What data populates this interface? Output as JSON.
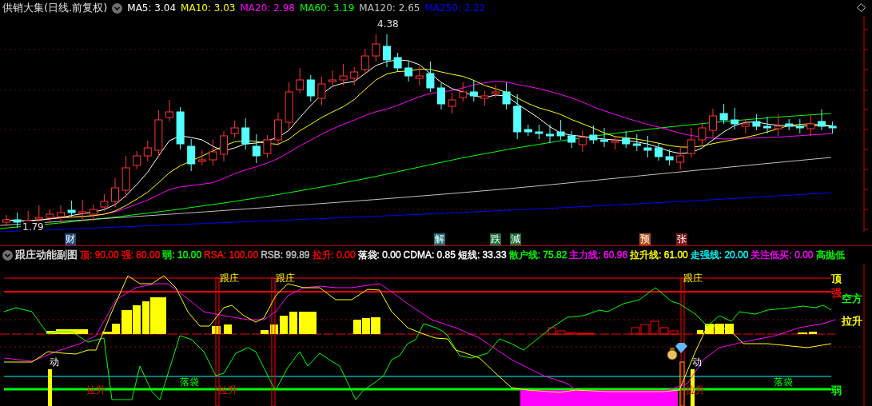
{
  "main_panel": {
    "title": "供销大集(日线.前复权)",
    "indicators": [
      {
        "label": "MA5:",
        "value": "3.04",
        "color": "#ffffff"
      },
      {
        "label": "MA10:",
        "value": "3.03",
        "color": "#ffff00"
      },
      {
        "label": "MA20:",
        "value": "2.98",
        "color": "#ff00ff"
      },
      {
        "label": "MA60:",
        "value": "3.19",
        "color": "#00ff00"
      },
      {
        "label": "MA120:",
        "value": "2.65",
        "color": "#c0c0c0"
      },
      {
        "label": "MA250:",
        "value": "2.22",
        "color": "#0000ff"
      }
    ],
    "high_label": "4.38",
    "low_label": "1.79"
  },
  "event_markers": [
    {
      "text": "财",
      "color": "#1e4a7a"
    },
    {
      "text": "解",
      "color": "#1a6e7a"
    },
    {
      "text": "跌",
      "color": "#1e6e3a"
    },
    {
      "text": "減",
      "color": "#1e6e3a"
    },
    {
      "text": "预",
      "color": "#b0501a"
    },
    {
      "text": "张",
      "color": "#7a1a1a"
    }
  ],
  "sub_panel": {
    "title": "跟庄动能副图",
    "indicators": [
      {
        "label": "顶:",
        "value": "90.00",
        "color": "#ff0000"
      },
      {
        "label": "强:",
        "value": "80.00",
        "color": "#ff0000"
      },
      {
        "label": "弱:",
        "value": "10.00",
        "color": "#00ff00"
      },
      {
        "label": "RSA:",
        "value": "100.00",
        "color": "#ff0000"
      },
      {
        "label": "RSB:",
        "value": "99.89",
        "color": "#c0c0c0"
      },
      {
        "label": "拉升:",
        "value": "0.00",
        "color": "#ff0000"
      },
      {
        "label": "落袋:",
        "value": "0.00",
        "color": "#ffffff"
      },
      {
        "label": "CDMA:",
        "value": "0.85",
        "color": "#ffffff"
      },
      {
        "label": "短线:",
        "value": "33.33",
        "color": "#ffffff"
      },
      {
        "label": "散户线:",
        "value": "75.82",
        "color": "#00ff00"
      },
      {
        "label": "主力线:",
        "value": "60.96",
        "color": "#ff00ff"
      },
      {
        "label": "拉升线:",
        "value": "61.00",
        "color": "#ffff00"
      },
      {
        "label": "走强线:",
        "value": "20.00",
        "color": "#00ffff"
      },
      {
        "label": "关注低买:",
        "value": "0.00",
        "color": "#ff00ff"
      },
      {
        "label": "高抛低",
        "color": "#00ff00"
      }
    ],
    "annotations": [
      {
        "text": "跟庄",
        "kind": "follow"
      },
      {
        "text": "跟庄",
        "kind": "follow"
      },
      {
        "text": "跟庄",
        "kind": "follow"
      },
      {
        "text": "动",
        "kind": "move"
      },
      {
        "text": "动",
        "kind": "move"
      },
      {
        "text": "拉升",
        "kind": "rise"
      },
      {
        "text": "拉升",
        "kind": "rise"
      },
      {
        "text": "拉升",
        "kind": "rise"
      },
      {
        "text": "落袋",
        "kind": "bag"
      },
      {
        "text": "落袋",
        "kind": "bag"
      }
    ],
    "level_labels": [
      {
        "text": "顶",
        "color": "#ffff00"
      },
      {
        "text": "强",
        "color": "#ff0000"
      },
      {
        "text": "空方",
        "color": "#00ff00"
      },
      {
        "text": "拉升",
        "color": "#ffff00"
      },
      {
        "text": "弱",
        "color": "#00ff00"
      }
    ]
  }
}
